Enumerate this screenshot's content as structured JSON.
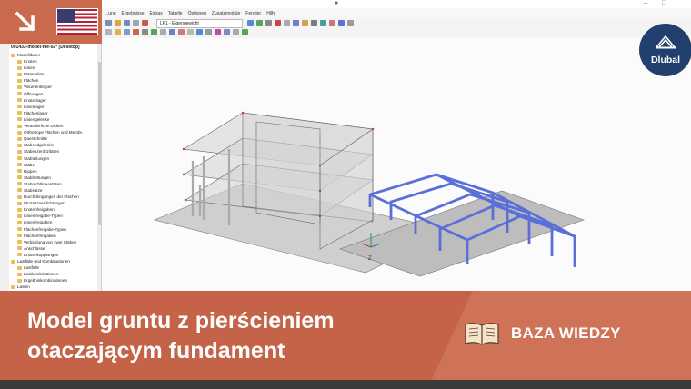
{
  "app": {
    "menu": [
      "...ung",
      "Ergebnisse",
      "Extras",
      "Tabelle",
      "Optionen",
      "Zusatzmodule",
      "Fenster",
      "Hilfe"
    ],
    "load_case_combo": "LF1 - Eigengewicht",
    "window_controls": [
      "–",
      "□"
    ]
  },
  "badge": {
    "flag": "us-flag-icon",
    "arrow": "arrow-down-right-icon"
  },
  "navigator": {
    "header": "001433-model-file-02* [Desktop]",
    "items": [
      {
        "label": "Modelldaten",
        "level": 0
      },
      {
        "label": "Knoten",
        "level": 1
      },
      {
        "label": "Linien",
        "level": 1
      },
      {
        "label": "Materialien",
        "level": 1
      },
      {
        "label": "Flächen",
        "level": 1
      },
      {
        "label": "Volumenkörper",
        "level": 1
      },
      {
        "label": "Öffnungen",
        "level": 1
      },
      {
        "label": "Knotenlager",
        "level": 1
      },
      {
        "label": "Linienlager",
        "level": 1
      },
      {
        "label": "Flächenlager",
        "level": 1
      },
      {
        "label": "Liniengelenke",
        "level": 1
      },
      {
        "label": "Veränderliche Dicken",
        "level": 1
      },
      {
        "label": "Orthotrope Flächen und Membr.",
        "level": 1
      },
      {
        "label": "Querschnitte",
        "level": 1
      },
      {
        "label": "Stabendgelenke",
        "level": 1
      },
      {
        "label": "Stabexzentrizitäten",
        "level": 1
      },
      {
        "label": "Stabteilungen",
        "level": 1
      },
      {
        "label": "Stäbe",
        "level": 1
      },
      {
        "label": "Rippen",
        "level": 1
      },
      {
        "label": "Stabbettungen",
        "level": 1
      },
      {
        "label": "Stabnichtlinearitäten",
        "level": 1
      },
      {
        "label": "Stabsätze",
        "level": 1
      },
      {
        "label": "Durchdringungen der Flächen",
        "level": 1
      },
      {
        "label": "FE-Netzverdichtungen",
        "level": 1
      },
      {
        "label": "Knotenfreigaben",
        "level": 1
      },
      {
        "label": "Linienfreigabe-Typen",
        "level": 1
      },
      {
        "label": "Linienfreigaben",
        "level": 1
      },
      {
        "label": "Flächenfreigabe-Typen",
        "level": 1
      },
      {
        "label": "Flächenfreigaben",
        "level": 1
      },
      {
        "label": "Verbindung von zwei Stäben",
        "level": 1
      },
      {
        "label": "Anschlüsse",
        "level": 1
      },
      {
        "label": "Knotenkopplungen",
        "level": 1
      },
      {
        "label": "Lastfälle und Kombinationen",
        "level": 0
      },
      {
        "label": "Lastfälle",
        "level": 1
      },
      {
        "label": "Lastkombinationen",
        "level": 1
      },
      {
        "label": "Ergebniskombinationen",
        "level": 1
      },
      {
        "label": "Lasten",
        "level": 0
      }
    ]
  },
  "viewport": {
    "axis_label": "Z"
  },
  "logo": {
    "name": "Dlubal"
  },
  "banner": {
    "title_lines": [
      "Model gruntu z pierścieniem",
      "otaczającym fundament"
    ],
    "category": "BAZA WIEDZY",
    "category_icon": "open-book-icon"
  },
  "colors": {
    "banner": "#c8694d",
    "logo": "#22406e",
    "frame": "#5b6fd8"
  }
}
